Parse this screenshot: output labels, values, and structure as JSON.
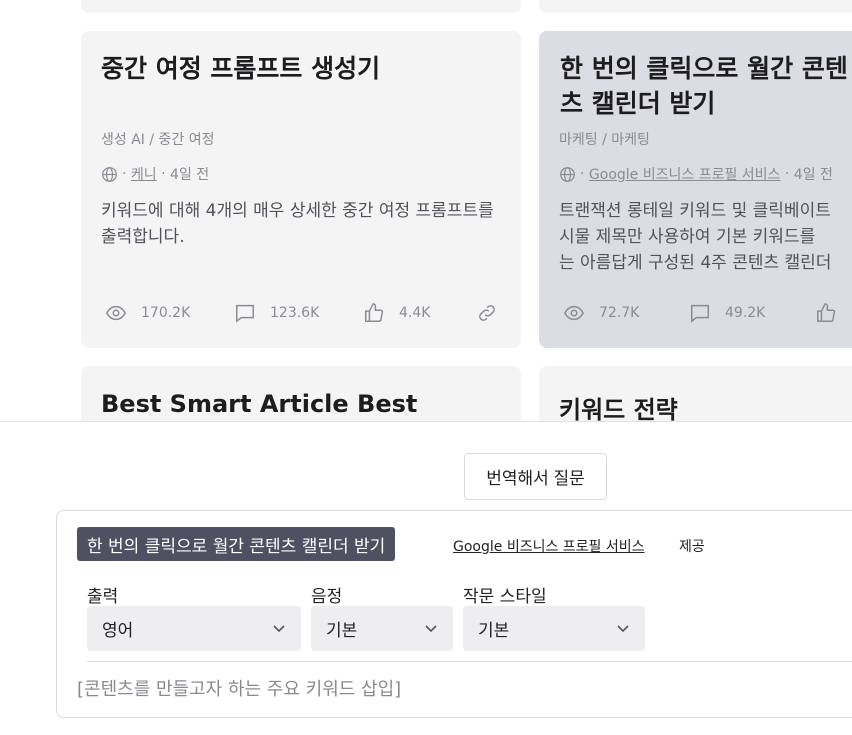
{
  "cards": [
    {
      "title": "중간 여정 프롬프트 생성기",
      "category": "생성 AI / 중간 여정",
      "author": "케니",
      "time": "4일 전",
      "description": "키워드에 대해 4개의 매우 상세한 중간 여정 프롬프트를 출력합니다.",
      "views": "170.2K",
      "comments": "123.6K",
      "likes": "4.4K"
    },
    {
      "title": "한 번의 클릭으로 월간 콘텐츠 캘린더 받기",
      "category": "마케팅 / 마케팅",
      "author": "Google 비즈니스 프로필 서비스",
      "time": "4일 전",
      "description_lines": [
        "트랜잭션 롱테일 키워드 및 클릭베이트",
        "시물 제목만 사용하여 기본 키워드를",
        "는 아름답게 구성된 4주 콘텐츠 캘린더"
      ],
      "views": "72.7K",
      "comments": "49.2K",
      "likes": ""
    }
  ],
  "lower_cards": [
    {
      "title": "Best Smart Article Best"
    },
    {
      "title": "키워드 전략"
    }
  ],
  "panel": {
    "translate_button": "번역해서 질문",
    "prompt_chip": "한 번의 클릭으로 월간 콘텐츠 캘린더 받기",
    "provider": "Google 비즈니스 프로필 서비스",
    "provided_by": "제공",
    "output_label": "출력",
    "output_value": "영어",
    "tone_label": "음정",
    "tone_value": "기본",
    "style_label": "작문 스타일",
    "style_value": "기본",
    "input_placeholder": "[콘텐츠를 만들고자 하는 주요 키워드 삽입]"
  },
  "colors": {
    "card_bg": "#f4f4f5",
    "card_highlight_bg": "#dcdce5",
    "chip_bg": "#4e5161",
    "muted_text": "#8a8a92"
  },
  "icons": [
    "globe-icon",
    "eye-icon",
    "comment-icon",
    "thumbs-up-icon",
    "link-icon",
    "chevron-down-icon"
  ]
}
